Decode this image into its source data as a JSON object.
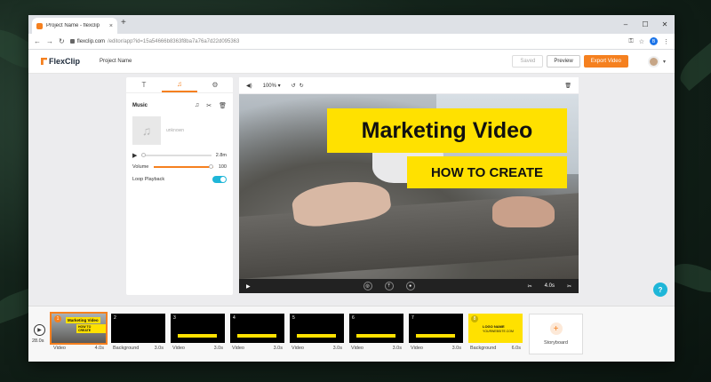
{
  "browser": {
    "tab_title": "Project Name - flexclip",
    "tab_close": "×",
    "new_tab": "+",
    "url_domain": "flexclip.com",
    "url_path": "/editor/app?id=15a54666b8363f8ba7a76a7d22d095363",
    "win_min": "–",
    "win_max": "☐",
    "win_close": "✕",
    "profile_initial": "B"
  },
  "app": {
    "logo_text": "FlexClip",
    "project_name": "Project Name",
    "saved_label": "Saved",
    "preview_label": "Preview",
    "export_label": "Export Video"
  },
  "left_panel": {
    "tab_text_icon": "T",
    "tab_music_icon": "♫",
    "tab_settings_icon": "⚙",
    "music_title": "Music",
    "music_name": "unknown",
    "music_duration": "2.8m",
    "volume_label": "Volume",
    "volume_value": "100",
    "loop_label": "Loop Playback"
  },
  "stage": {
    "zoom": "100%",
    "title": "Marketing Video",
    "subtitle": "HOW TO CREATE",
    "duration": "4.0s"
  },
  "timeline": {
    "total_duration": "28.0s",
    "clips": [
      {
        "num": "1",
        "type": "Video",
        "duration": "4.0s",
        "mini_title": "Marketing Video",
        "mini_sub": "HOW TO CREATE"
      },
      {
        "num": "2",
        "type": "Background",
        "duration": "3.0s"
      },
      {
        "num": "3",
        "type": "Video",
        "duration": "3.0s"
      },
      {
        "num": "4",
        "type": "Video",
        "duration": "3.0s"
      },
      {
        "num": "5",
        "type": "Video",
        "duration": "3.0s"
      },
      {
        "num": "6",
        "type": "Video",
        "duration": "3.0s"
      },
      {
        "num": "7",
        "type": "Video",
        "duration": "3.0s"
      },
      {
        "num": "8",
        "type": "Background",
        "duration": "6.0s",
        "logo_name": "LOGO NAME",
        "logo_url": "YOURWEBSITE.COM"
      }
    ],
    "storyboard_label": "Storyboard"
  },
  "help_label": "?",
  "colors": {
    "accent": "#f5801f",
    "highlight": "#ffe100",
    "toggle": "#1fb6d8"
  }
}
